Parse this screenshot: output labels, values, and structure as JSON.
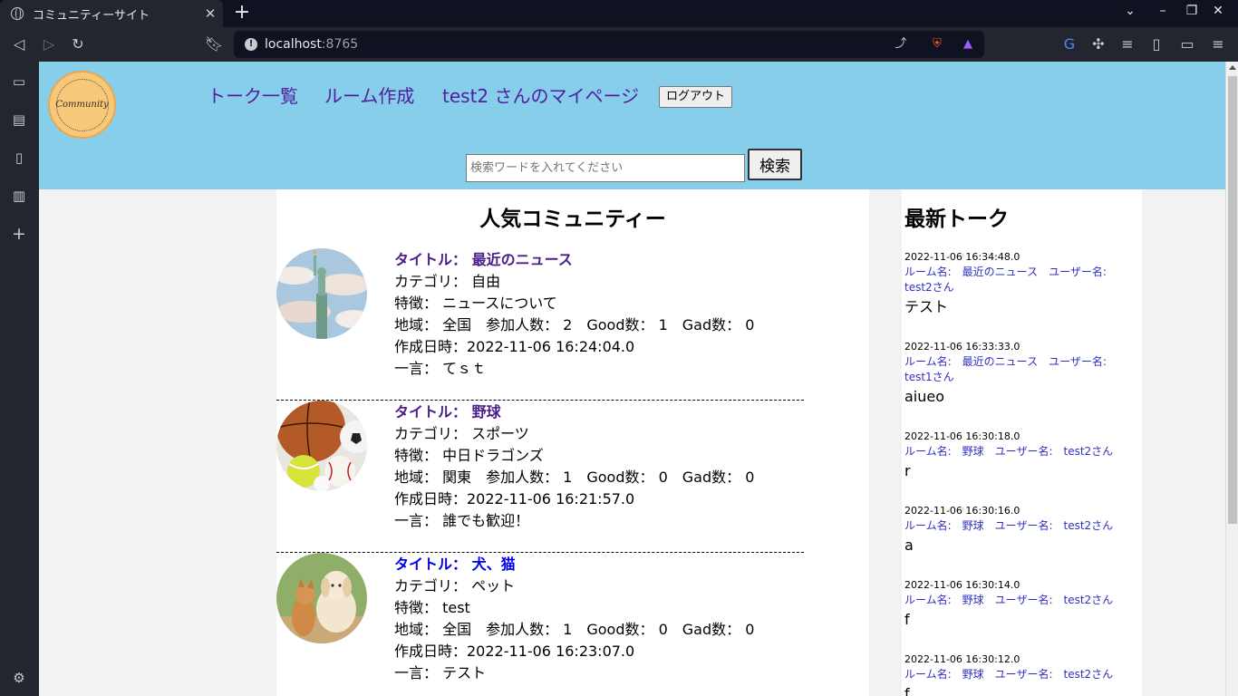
{
  "browser": {
    "tab_title": "コミュニティーサイト",
    "url_host": "localhost",
    "url_port": ":8765"
  },
  "header": {
    "nav": [
      "トーク一覧",
      "ルーム作成",
      "test2 さんのマイページ"
    ],
    "logout_label": "ログアウト",
    "logo_text": "Community",
    "search_placeholder": "検索ワードを入れてください",
    "search_button": "検索"
  },
  "main": {
    "title": "人気コミュニティー",
    "communities": [
      {
        "title": "タイトル： 最近のニュース",
        "category": "カテゴリ： 自由",
        "feature": "特徴： ニュースについて",
        "stats": "地域： 全国　参加人数： 2　Good数： 1　Gad数： 0",
        "created": "作成日時：2022-11-06 16:24:04.0",
        "comment": "一言： てｓｔ",
        "image": "statue-of-liberty-image"
      },
      {
        "title": "タイトル： 野球",
        "category": "カテゴリ： スポーツ",
        "feature": "特徴： 中日ドラゴンズ",
        "stats": "地域： 関東　参加人数： 1　Good数： 0　Gad数： 0",
        "created": "作成日時：2022-11-06 16:21:57.0",
        "comment": "一言： 誰でも歓迎！",
        "image": "sports-balls-image"
      },
      {
        "title": "タイトル： 犬、猫",
        "category": "カテゴリ： ペット",
        "feature": "特徴： test",
        "stats": "地域： 全国　参加人数： 1　Good数： 0　Gad数： 0",
        "created": "作成日時：2022-11-06 16:23:07.0",
        "comment": "一言： テスト",
        "image": "dog-and-cat-image"
      }
    ]
  },
  "side": {
    "title": "最新トーク",
    "talks": [
      {
        "date": "2022-11-06 16:34:48.0",
        "meta": "ルーム名:　最近のニュース　ユーザー名:　test2さん",
        "body": "テスト"
      },
      {
        "date": "2022-11-06 16:33:33.0",
        "meta": "ルーム名:　最近のニュース　ユーザー名:　test1さん",
        "body": "aiueo"
      },
      {
        "date": "2022-11-06 16:30:18.0",
        "meta": "ルーム名:　野球　ユーザー名:　test2さん",
        "body": "r"
      },
      {
        "date": "2022-11-06 16:30:16.0",
        "meta": "ルーム名:　野球　ユーザー名:　test2さん",
        "body": "a"
      },
      {
        "date": "2022-11-06 16:30:14.0",
        "meta": "ルーム名:　野球　ユーザー名:　test2さん",
        "body": "f"
      },
      {
        "date": "2022-11-06 16:30:12.0",
        "meta": "ルーム名:　野球　ユーザー名:　test2さん",
        "body": "f"
      }
    ]
  },
  "colors": {
    "header_bg": "#87ceeb",
    "visited_link": "#4b1d8a",
    "link": "#0000ee"
  }
}
